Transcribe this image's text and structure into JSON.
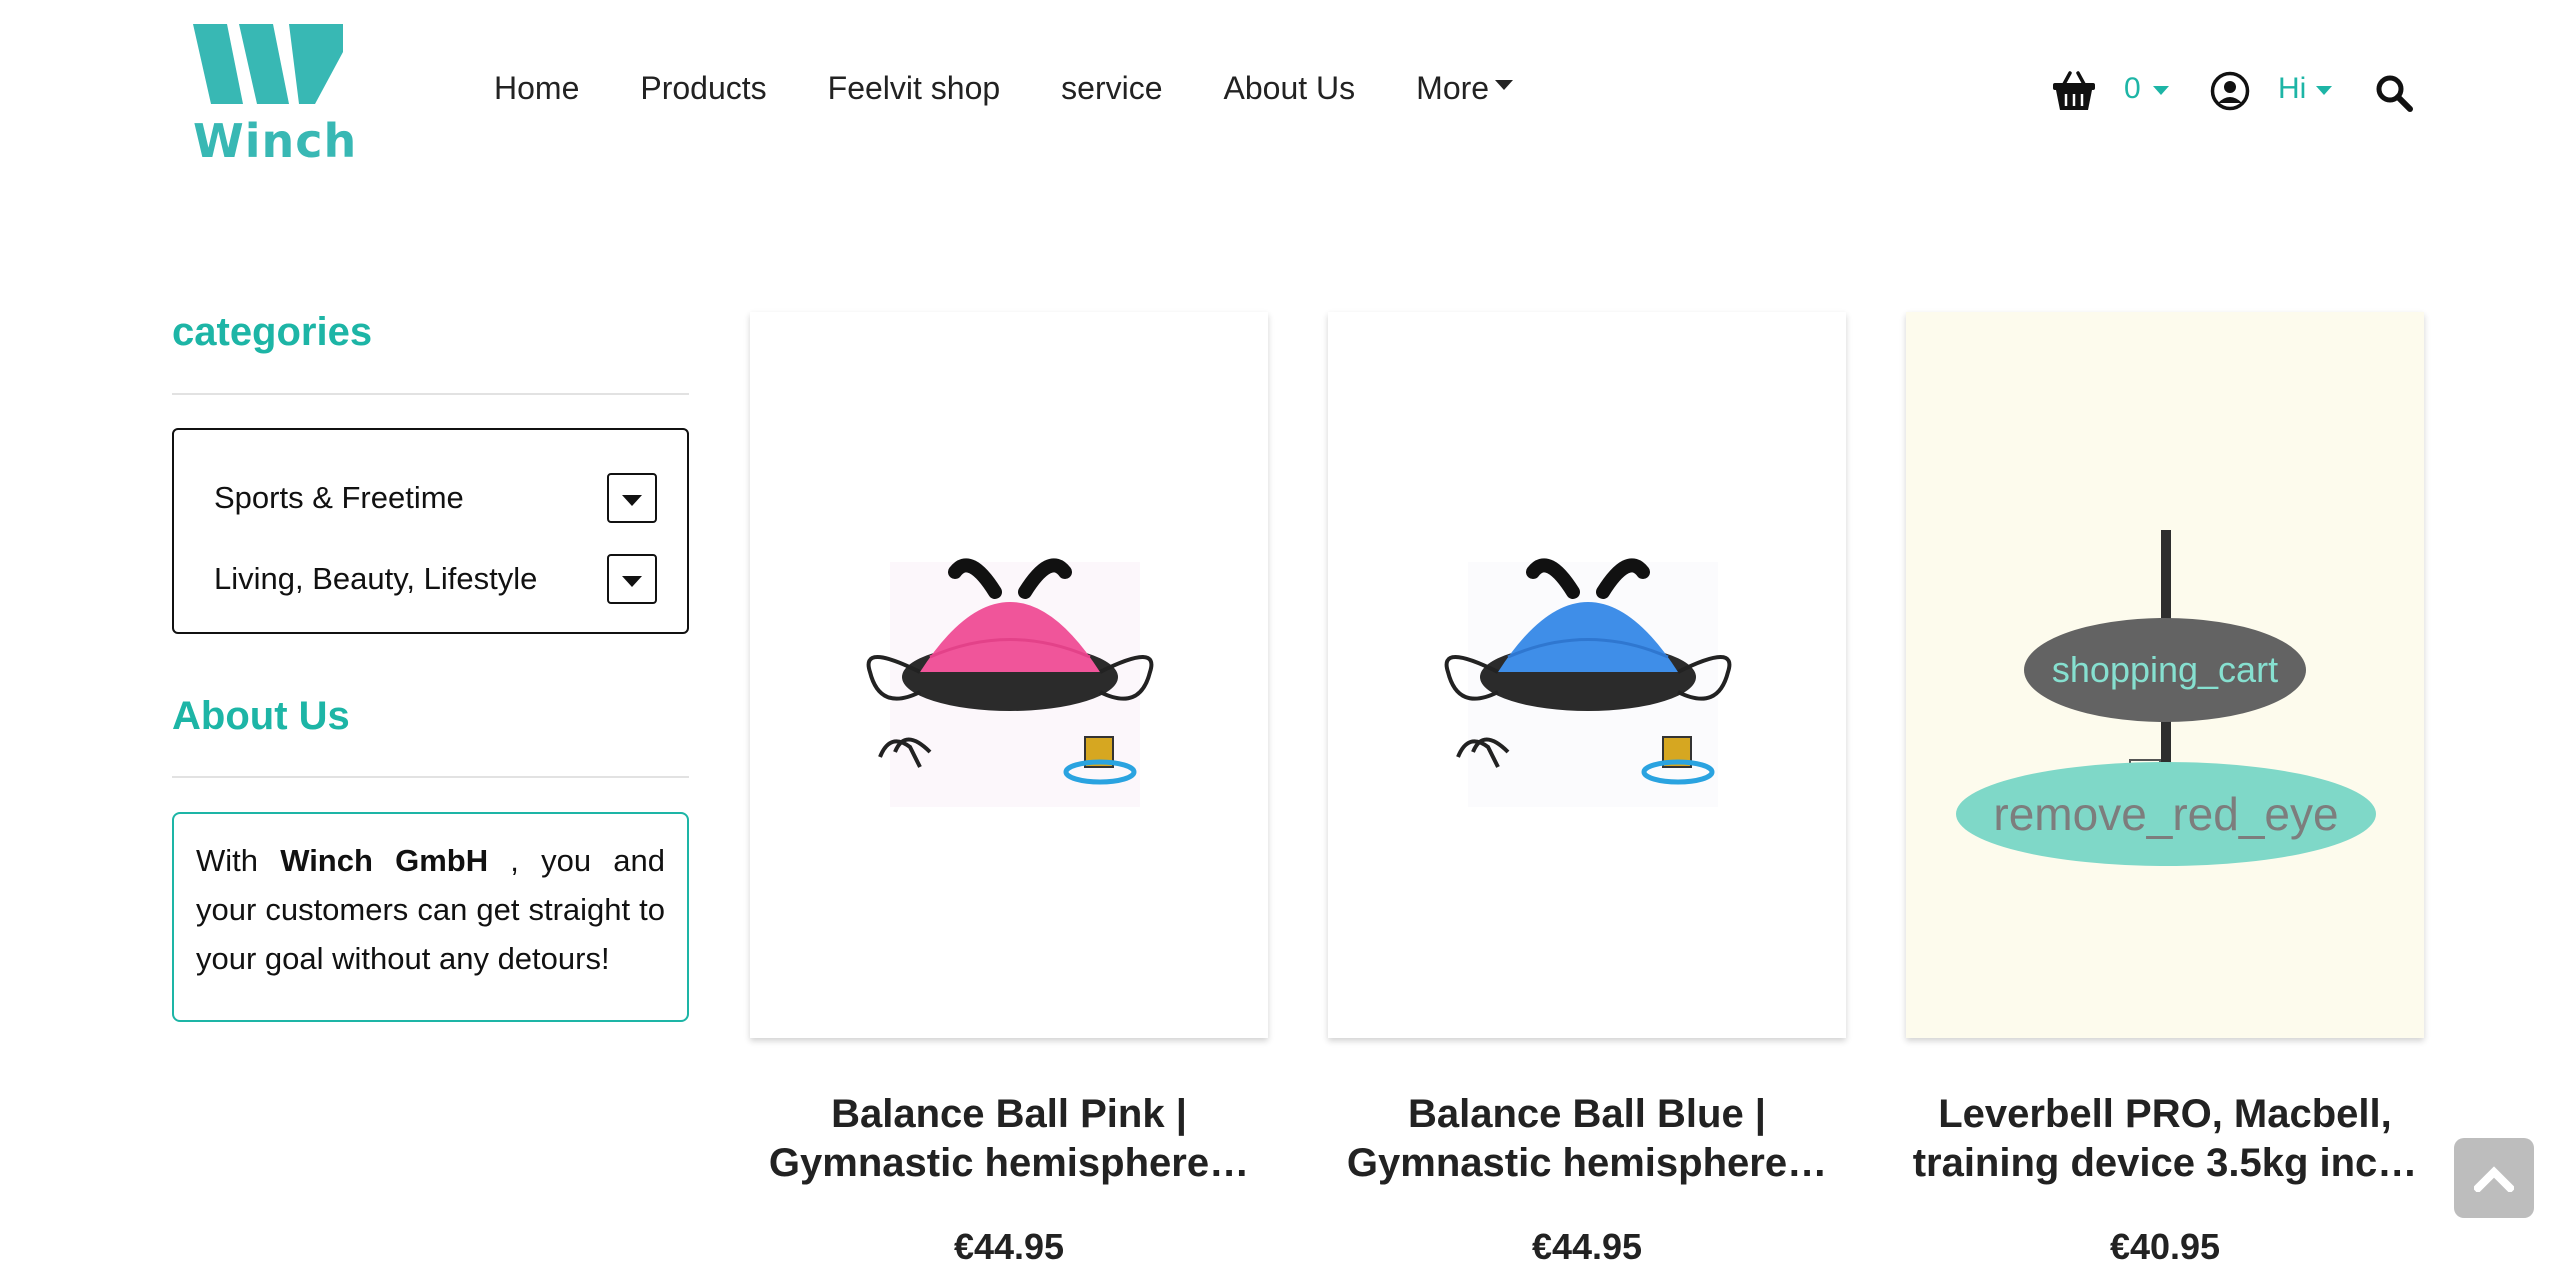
{
  "brand": {
    "name": "Winch",
    "color": "#38b8b4"
  },
  "nav": {
    "items": [
      "Home",
      "Products",
      "Feelvit shop",
      "service",
      "About Us"
    ],
    "more_label": "More"
  },
  "header": {
    "cart_count": "0",
    "greeting": "Hi",
    "icons": [
      "shopping-basket-icon",
      "account-circle-icon",
      "search-icon"
    ]
  },
  "sidebar": {
    "categories_heading": "categories",
    "categories": [
      "Sports & Freetime",
      "Living, Beauty, Lifestyle"
    ],
    "about_heading": "About Us",
    "about_text": {
      "prefix": "With ",
      "company": "Winch GmbH",
      "suffix": " , you and your customers can get straight to your goal without any detours!"
    }
  },
  "products": [
    {
      "name_line1": "Balance Ball Pink |",
      "name_line2": "Gymnastic hemisphere…",
      "price": "€44.95",
      "color": "#f0559a"
    },
    {
      "name_line1": "Balance Ball Blue |",
      "name_line2": "Gymnastic hemisphere…",
      "price": "€44.95",
      "color": "#3f8ee8"
    },
    {
      "name_line1": "Leverbell PRO, Macbell,",
      "name_line2": "training device 3.5kg inc…",
      "price": "€40.95",
      "overlay_cart": "shopping_cart",
      "overlay_view": "remove_red_eye"
    }
  ],
  "accent_color": "#1db5a6"
}
